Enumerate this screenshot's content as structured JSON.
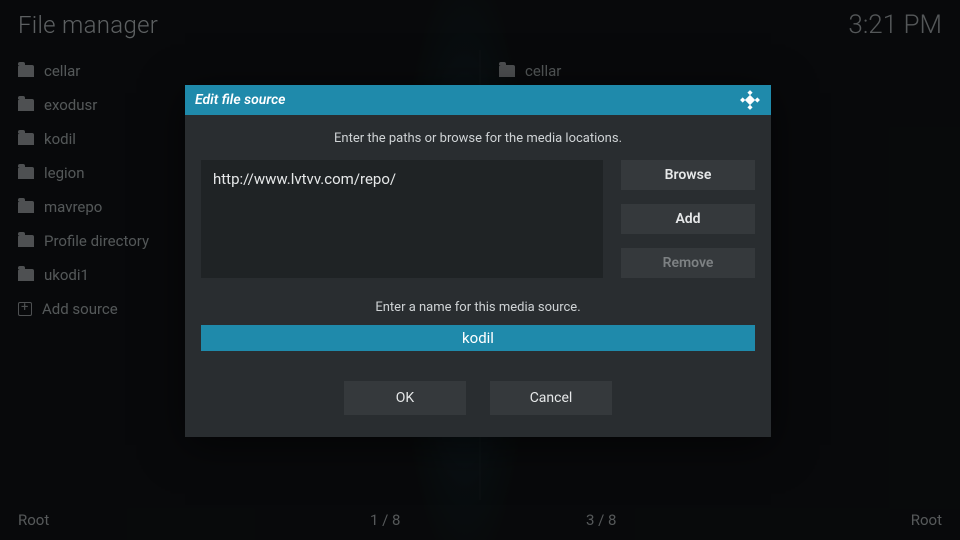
{
  "header": {
    "title": "File manager",
    "clock": "3:21 PM"
  },
  "panes": {
    "left": {
      "items": [
        {
          "label": "cellar"
        },
        {
          "label": "exodusr"
        },
        {
          "label": "kodil"
        },
        {
          "label": "legion"
        },
        {
          "label": "mavrepo"
        },
        {
          "label": "Profile directory"
        },
        {
          "label": "ukodi1"
        }
      ],
      "add_label": "Add source",
      "footer_path": "Root",
      "footer_pos": "1 / 8"
    },
    "right": {
      "items": [
        {
          "label": "cellar"
        }
      ],
      "footer_path": "Root",
      "footer_pos": "3 / 8"
    }
  },
  "dialog": {
    "title": "Edit file source",
    "instruction_paths": "Enter the paths or browse for the media locations.",
    "path_value": "http://www.lvtvv.com/repo/",
    "btn_browse": "Browse",
    "btn_add": "Add",
    "btn_remove": "Remove",
    "instruction_name": "Enter a name for this media source.",
    "name_value": "kodil",
    "btn_ok": "OK",
    "btn_cancel": "Cancel"
  }
}
